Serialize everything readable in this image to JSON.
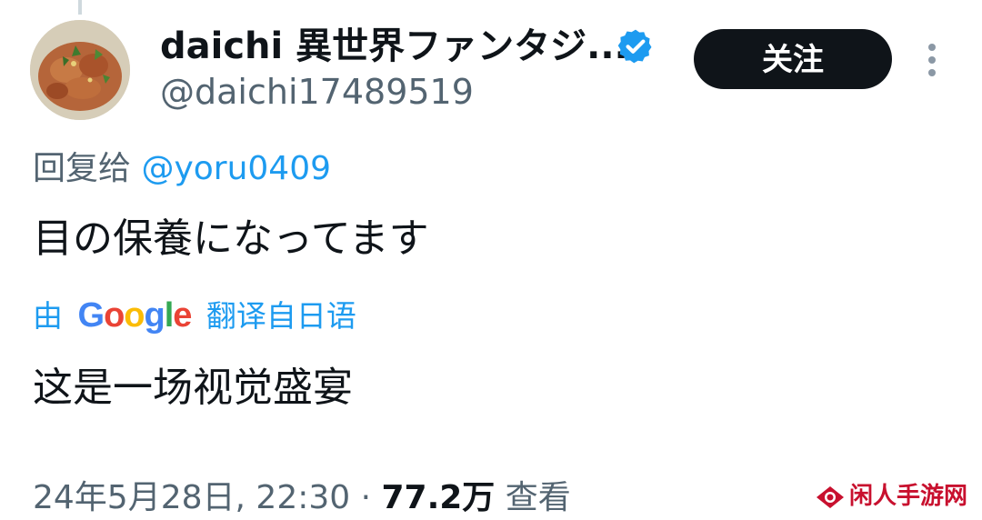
{
  "author": {
    "display_name": "daichi 異世界ファンタジ...",
    "handle": "@daichi17489519",
    "avatar_icon": "avatar-photo",
    "verified_icon": "verified-badge-icon"
  },
  "actions": {
    "follow_label": "关注",
    "more_icon": "more-vertical-icon"
  },
  "reply": {
    "prefix": "回复给 ",
    "to_handle": "@yoru0409"
  },
  "tweet": {
    "text": "目の保養になってます"
  },
  "translation": {
    "prefix": "由 ",
    "provider": "Google",
    "suffix": " 翻译自日语",
    "text": "这是一场视觉盛宴"
  },
  "meta": {
    "timestamp": "24年5月28日, 22:30 · ",
    "views_count": "77.2万",
    "views_label": " 查看"
  },
  "watermark": {
    "text": "闲人手游网"
  },
  "colors": {
    "link": "#1d9bf0",
    "secondary_text": "#536471",
    "primary_text": "#0f1419",
    "button_bg": "#0f1419",
    "watermark": "#c8102e"
  }
}
